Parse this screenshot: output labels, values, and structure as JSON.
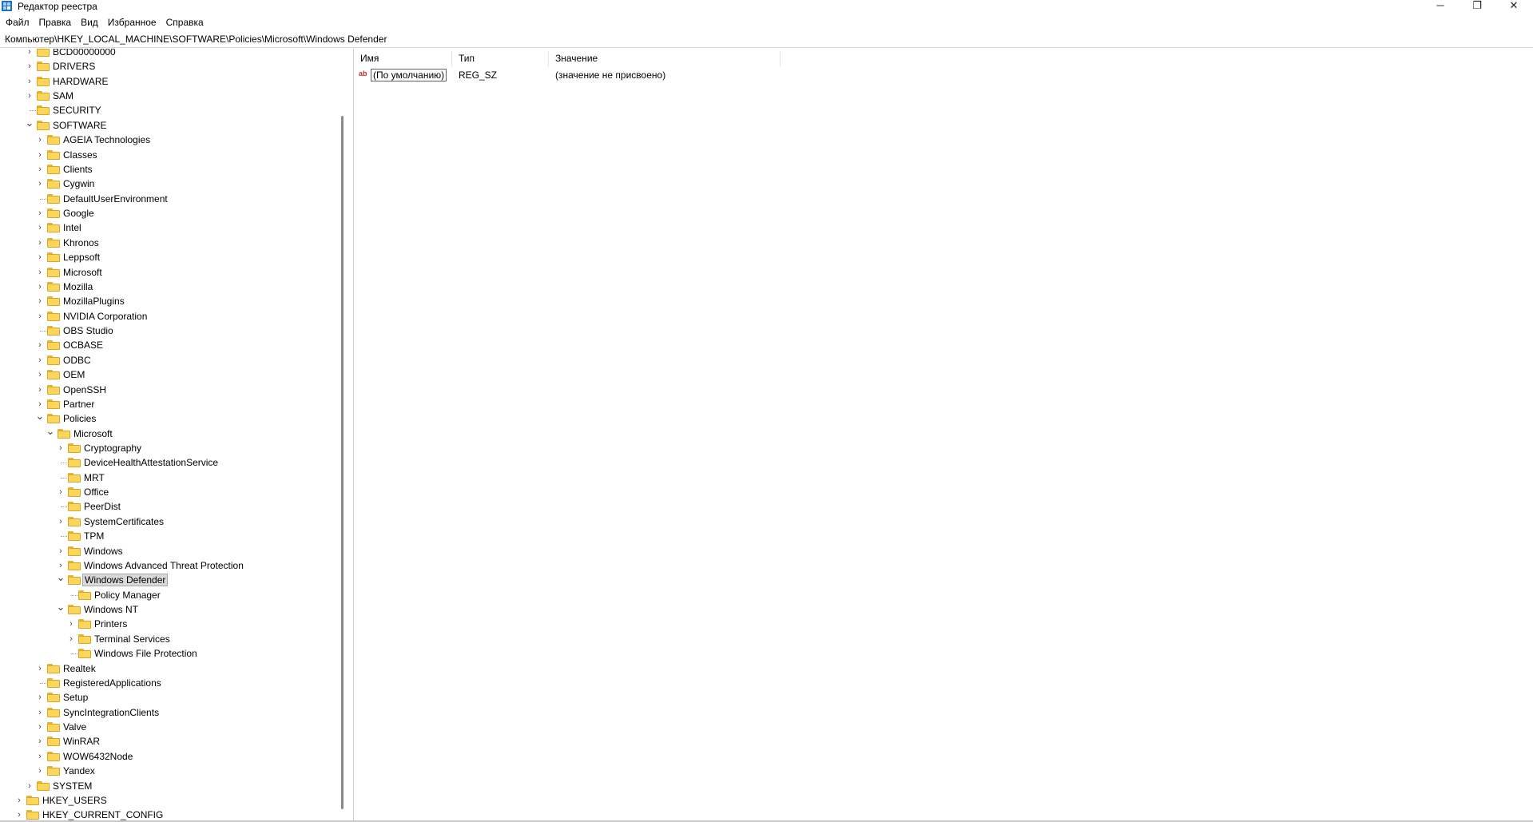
{
  "window": {
    "title": "Редактор реестра",
    "minimize_glyph": "─",
    "maximize_glyph": "❐",
    "close_glyph": "✕"
  },
  "menu": [
    "Файл",
    "Правка",
    "Вид",
    "Избранное",
    "Справка"
  ],
  "address": "Компьютер\\HKEY_LOCAL_MACHINE\\SOFTWARE\\Policies\\Microsoft\\Windows Defender",
  "tree": [
    {
      "label": "BCD00000000",
      "level": 2,
      "expander": "collapsed"
    },
    {
      "label": "DRIVERS",
      "level": 2,
      "expander": "collapsed"
    },
    {
      "label": "HARDWARE",
      "level": 2,
      "expander": "collapsed"
    },
    {
      "label": "SAM",
      "level": 2,
      "expander": "collapsed"
    },
    {
      "label": "SECURITY",
      "level": 2,
      "expander": "none"
    },
    {
      "label": "SOFTWARE",
      "level": 2,
      "expander": "expanded"
    },
    {
      "label": "AGEIA Technologies",
      "level": 3,
      "expander": "collapsed"
    },
    {
      "label": "Classes",
      "level": 3,
      "expander": "collapsed"
    },
    {
      "label": "Clients",
      "level": 3,
      "expander": "collapsed"
    },
    {
      "label": "Cygwin",
      "level": 3,
      "expander": "collapsed"
    },
    {
      "label": "DefaultUserEnvironment",
      "level": 3,
      "expander": "none"
    },
    {
      "label": "Google",
      "level": 3,
      "expander": "collapsed"
    },
    {
      "label": "Intel",
      "level": 3,
      "expander": "collapsed"
    },
    {
      "label": "Khronos",
      "level": 3,
      "expander": "collapsed"
    },
    {
      "label": "Leppsoft",
      "level": 3,
      "expander": "collapsed"
    },
    {
      "label": "Microsoft",
      "level": 3,
      "expander": "collapsed"
    },
    {
      "label": "Mozilla",
      "level": 3,
      "expander": "collapsed"
    },
    {
      "label": "MozillaPlugins",
      "level": 3,
      "expander": "collapsed"
    },
    {
      "label": "NVIDIA Corporation",
      "level": 3,
      "expander": "collapsed"
    },
    {
      "label": "OBS Studio",
      "level": 3,
      "expander": "none"
    },
    {
      "label": "OCBASE",
      "level": 3,
      "expander": "collapsed"
    },
    {
      "label": "ODBC",
      "level": 3,
      "expander": "collapsed"
    },
    {
      "label": "OEM",
      "level": 3,
      "expander": "collapsed"
    },
    {
      "label": "OpenSSH",
      "level": 3,
      "expander": "collapsed"
    },
    {
      "label": "Partner",
      "level": 3,
      "expander": "collapsed"
    },
    {
      "label": "Policies",
      "level": 3,
      "expander": "expanded"
    },
    {
      "label": "Microsoft",
      "level": 4,
      "expander": "expanded"
    },
    {
      "label": "Cryptography",
      "level": 5,
      "expander": "collapsed"
    },
    {
      "label": "DeviceHealthAttestationService",
      "level": 5,
      "expander": "none"
    },
    {
      "label": "MRT",
      "level": 5,
      "expander": "none"
    },
    {
      "label": "Office",
      "level": 5,
      "expander": "collapsed"
    },
    {
      "label": "PeerDist",
      "level": 5,
      "expander": "none"
    },
    {
      "label": "SystemCertificates",
      "level": 5,
      "expander": "collapsed"
    },
    {
      "label": "TPM",
      "level": 5,
      "expander": "none"
    },
    {
      "label": "Windows",
      "level": 5,
      "expander": "collapsed"
    },
    {
      "label": "Windows Advanced Threat Protection",
      "level": 5,
      "expander": "collapsed"
    },
    {
      "label": "Windows Defender",
      "level": 5,
      "expander": "expanded",
      "selected": true
    },
    {
      "label": "Policy Manager",
      "level": 6,
      "expander": "none"
    },
    {
      "label": "Windows NT",
      "level": 5,
      "expander": "expanded"
    },
    {
      "label": "Printers",
      "level": 6,
      "expander": "collapsed"
    },
    {
      "label": "Terminal Services",
      "level": 6,
      "expander": "collapsed"
    },
    {
      "label": "Windows File Protection",
      "level": 6,
      "expander": "none"
    },
    {
      "label": "Realtek",
      "level": 3,
      "expander": "collapsed"
    },
    {
      "label": "RegisteredApplications",
      "level": 3,
      "expander": "none"
    },
    {
      "label": "Setup",
      "level": 3,
      "expander": "collapsed"
    },
    {
      "label": "SyncIntegrationClients",
      "level": 3,
      "expander": "collapsed"
    },
    {
      "label": "Valve",
      "level": 3,
      "expander": "collapsed"
    },
    {
      "label": "WinRAR",
      "level": 3,
      "expander": "collapsed"
    },
    {
      "label": "WOW6432Node",
      "level": 3,
      "expander": "collapsed"
    },
    {
      "label": "Yandex",
      "level": 3,
      "expander": "collapsed"
    },
    {
      "label": "SYSTEM",
      "level": 2,
      "expander": "collapsed"
    },
    {
      "label": "HKEY_USERS",
      "level": 1,
      "expander": "collapsed"
    },
    {
      "label": "HKEY_CURRENT_CONFIG",
      "level": 1,
      "expander": "collapsed"
    }
  ],
  "list": {
    "columns": {
      "name": "Имя",
      "type": "Тип",
      "value": "Значение"
    },
    "rows": [
      {
        "icon": "ab",
        "name": "(По умолчанию)",
        "type": "REG_SZ",
        "value": "(значение не присвоено)"
      }
    ]
  }
}
